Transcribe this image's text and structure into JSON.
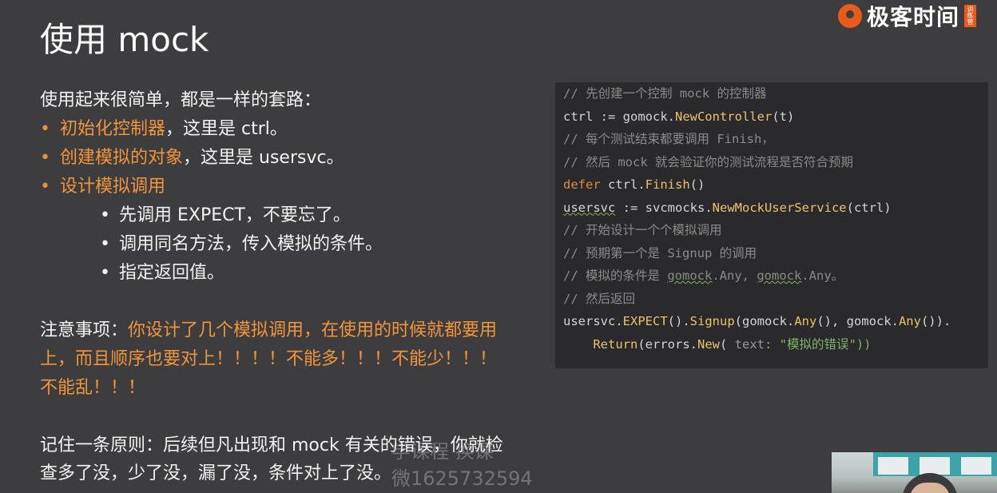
{
  "title": "使用 mock",
  "logo": {
    "text": "极客时间",
    "tag": "训练营"
  },
  "intro": "使用起来很简单，都是一样的套路：",
  "bullets": [
    {
      "label": "初始化控制器",
      "rest": "，这里是 ctrl。"
    },
    {
      "label": "创建模拟的对象",
      "rest": "，这里是 usersvc。"
    },
    {
      "label": "设计模拟调用",
      "rest": ""
    }
  ],
  "sub_bullets": [
    "先调用 EXPECT，不要忘了。",
    "调用同名方法，传入模拟的条件。",
    "指定返回值。"
  ],
  "notice": {
    "label": "注意事项：",
    "text": "你设计了几个模拟调用，在使用的时候就都要用上，而且顺序也要对上！！！！不能多！！！不能少！！！不能乱！！！"
  },
  "principle": "记住一条原则：后续但凡出现和 mock 有关的错误，你就检查多了没，少了没，漏了没，条件对上了没。",
  "code": {
    "l1": "// 先创建一个控制 mock 的控制器",
    "l2a": "ctrl := gomock.",
    "l2b": "NewController",
    "l2c": "(t)",
    "l3": "// 每个测试结束都要调用 Finish，",
    "l4": "// 然后 mock 就会验证你的测试流程是否符合预期",
    "l5a": "defer",
    "l5b": " ctrl.",
    "l5c": "Finish",
    "l5d": "()",
    "l6a": "usersvc",
    "l6b": " := svcmocks.",
    "l6c": "NewMockUserService",
    "l6d": "(ctrl)",
    "l7": "// 开始设计一个个模拟调用",
    "l8": "// 预期第一个是 Signup 的调用",
    "l9a": "// 模拟的条件是 ",
    "l9b": "gomock",
    "l9c": ".Any, ",
    "l9d": "gomock",
    "l9e": ".Any。",
    "l10": "// 然后返回",
    "l11a": "usersvc.",
    "l11b": "EXPECT",
    "l11c": "().",
    "l11d": "Signup",
    "l11e": "(gomock.",
    "l11f": "Any",
    "l11g": "(), gomock.",
    "l11h": "Any",
    "l11i": "()).",
    "l12a": "    ",
    "l12b": "Return",
    "l12c": "(errors.",
    "l12d": "New",
    "l12e": "( ",
    "l12f": "text:",
    "l12g": " \"模拟的错误\"))"
  },
  "watermark": {
    "line1": "学课程 换课",
    "line2": "微16257325​94"
  }
}
